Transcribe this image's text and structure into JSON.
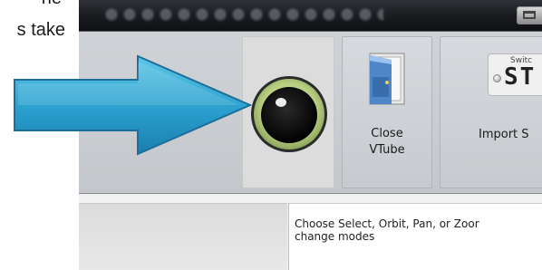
{
  "document": {
    "line1": "he",
    "line2": "s take"
  },
  "window": {
    "titlebar": {
      "restore_icon": "restore-window-icon"
    }
  },
  "ribbon": {
    "view_button": {
      "icon": "eye-icon"
    },
    "close_button": {
      "icon": "door-exit-icon",
      "label_line1": "Close",
      "label_line2": "VTube"
    },
    "import_button": {
      "icon": "switch-logo-icon",
      "logo_small_text": "Switc",
      "logo_big_text": "ST",
      "label": "Import S"
    }
  },
  "help": {
    "line1": "Choose Select, Orbit, Pan, or Zoor",
    "line2": "change modes"
  },
  "annotation": {
    "icon": "blue-arrow-icon"
  }
}
